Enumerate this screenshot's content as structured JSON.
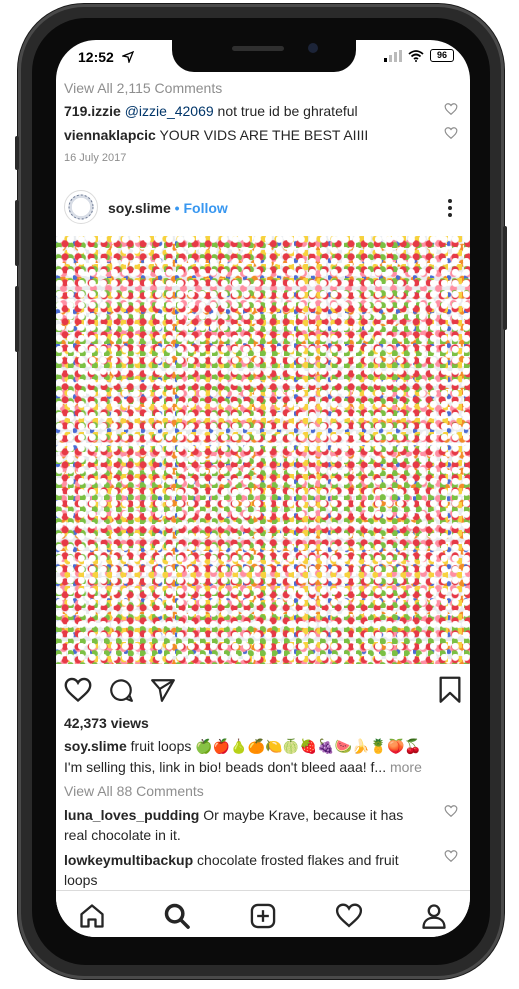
{
  "status": {
    "time": "12:52",
    "battery": "96"
  },
  "prev_post": {
    "view_all": "View All 2,115 Comments",
    "comments": [
      {
        "user": "719.izzie",
        "mention": "@izzie_42069",
        "text": " not true id be ghrateful"
      },
      {
        "user": "viennaklapcic",
        "text": " YOUR VIDS ARE THE BEST AIIII"
      }
    ],
    "date": "16 July 2017"
  },
  "post": {
    "username": "soy.slime",
    "separator": " • ",
    "follow": "Follow",
    "views": "42,373 views",
    "caption_user": "soy.slime",
    "caption_text": " fruit loops 🍏🍎🍐🍊🍋🍈🍓🍇🍉🍌🍍🍑🍒",
    "caption_line2": "I'm selling this, link in bio! beads don't bleed aaa! f...",
    "more": " more",
    "view_all": "View All 88 Comments",
    "comments": [
      {
        "user": "luna_loves_pudding",
        "text": " Or maybe Krave, because it has real chocolate in it."
      },
      {
        "user": "lowkeymultibackup",
        "text": " chocolate frosted flakes and fruit loops"
      }
    ]
  },
  "nav": [
    "home-icon",
    "search-icon",
    "add-icon",
    "activity-icon",
    "profile-icon"
  ]
}
